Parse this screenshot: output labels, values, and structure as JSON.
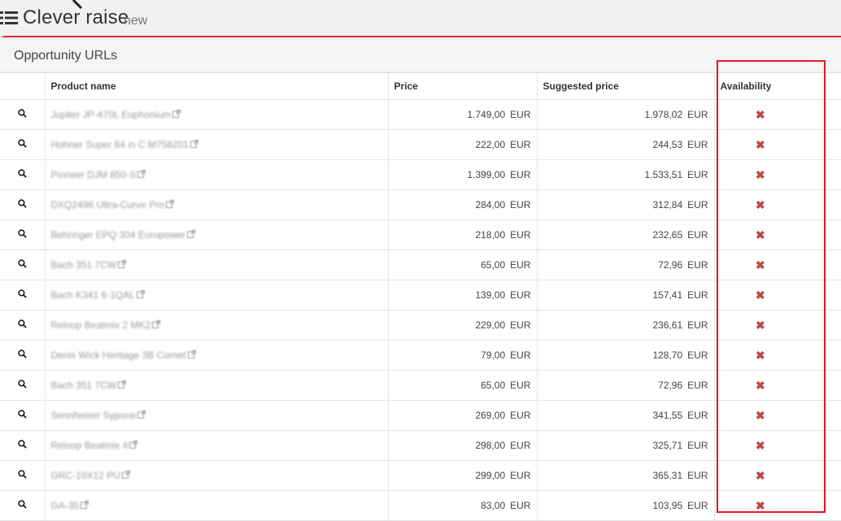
{
  "header": {
    "title": "Clever raise",
    "subtitle": "new",
    "menu_icon": "list-icon"
  },
  "panel": {
    "title": "Opportunity URLs"
  },
  "table": {
    "columns": [
      "",
      "Product name",
      "Price",
      "Suggested price",
      "Availability"
    ],
    "currency": "EUR",
    "rows": [
      {
        "name": "Jupiter JP-470L Euphonium",
        "price": "1.749,00",
        "suggested": "1.978,02",
        "available": false
      },
      {
        "name": "Hohner Super 64 in C M758201",
        "price": "222,00",
        "suggested": "244,53",
        "available": false
      },
      {
        "name": "Pioneer DJM 850-S",
        "price": "1.399,00",
        "suggested": "1.533,51",
        "available": false
      },
      {
        "name": "DXQ2496 Ultra-Curve Pro",
        "price": "284,00",
        "suggested": "312,84",
        "available": false
      },
      {
        "name": "Behringer EPQ 304 Europower",
        "price": "218,00",
        "suggested": "232,65",
        "available": false
      },
      {
        "name": "Bach 351 7CW",
        "price": "65,00",
        "suggested": "72,96",
        "available": false
      },
      {
        "name": "Bach K341 6-1QAL",
        "price": "139,00",
        "suggested": "157,41",
        "available": false
      },
      {
        "name": "Reloop Beatmix 2 MK2",
        "price": "229,00",
        "suggested": "236,61",
        "available": false
      },
      {
        "name": "Denis Wick Heritage 3B Cornet",
        "price": "79,00",
        "suggested": "128,70",
        "available": false
      },
      {
        "name": "Bach 351 7CW",
        "price": "65,00",
        "suggested": "72,96",
        "available": false
      },
      {
        "name": "Sennheiser Sypone",
        "price": "269,00",
        "suggested": "341,55",
        "available": false
      },
      {
        "name": "Reloop Beatmix 4",
        "price": "298,00",
        "suggested": "325,71",
        "available": false
      },
      {
        "name": "GRC-10X12 PU",
        "price": "299,00",
        "suggested": "365,31",
        "available": false
      },
      {
        "name": "GA-35",
        "price": "83,00",
        "suggested": "103,95",
        "available": false
      }
    ]
  },
  "colors": {
    "accent": "#c9302c",
    "unavailable": "#b94a48",
    "highlight_box": "#e5161c"
  }
}
